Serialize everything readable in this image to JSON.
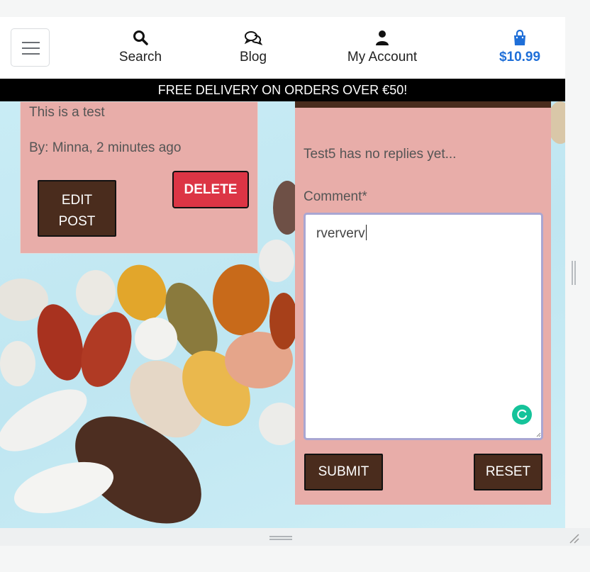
{
  "header": {
    "nav": {
      "search": "Search",
      "blog": "Blog",
      "account": "My Account",
      "cart_total": "$10.99"
    },
    "banner": "FREE DELIVERY ON ORDERS OVER €50!"
  },
  "post": {
    "body": "This is a test",
    "meta": "By: Minna, 2 minutes ago",
    "edit_label_line1": "EDIT",
    "edit_label_line2": "POST",
    "delete_label": "DELETE"
  },
  "comments": {
    "no_replies": "Test5 has no replies yet...",
    "label": "Comment*",
    "value": "rververv",
    "submit_label": "SUBMIT",
    "reset_label": "RESET"
  },
  "colors": {
    "accent_brown": "#4a2c1d",
    "card_pink": "#e8ada9",
    "danger_red": "#dc3545",
    "cart_blue": "#1f6fd8",
    "grammarly_green": "#15c39a"
  },
  "icons": [
    "menu-icon",
    "search-icon",
    "comments-icon",
    "user-icon",
    "shopping-bag-icon",
    "grammar-check-icon"
  ]
}
